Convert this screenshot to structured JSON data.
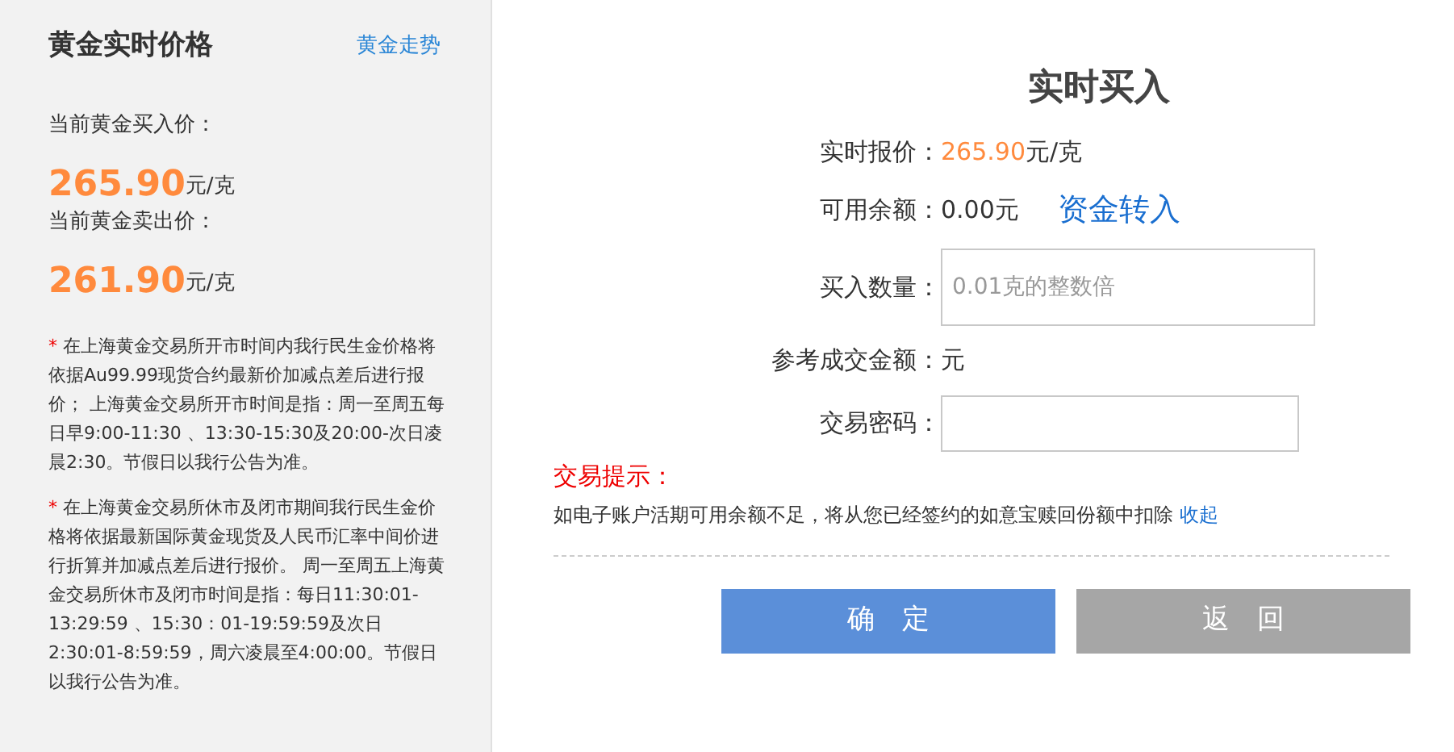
{
  "sidebar": {
    "title": "黄金实时价格",
    "trend_link": "黄金走势",
    "prices": [
      {
        "label": "当前黄金买入价：",
        "value": "265.90",
        "unit": "元/克"
      },
      {
        "label": "当前黄金卖出价：",
        "value": "261.90",
        "unit": "元/克"
      }
    ],
    "notes": [
      {
        "mark": "*",
        "text": "在上海黄金交易所开市时间内我行民生金价格将依据Au99.99现货合约最新价加减点差后进行报价； 上海黄金交易所开市时间是指：周一至周五每日早9:00-11:30 、13:30-15:30及20:00-次日凌晨2:30。节假日以我行公告为准。"
      },
      {
        "mark": "*",
        "text": "在上海黄金交易所休市及闭市期间我行民生金价格将依据最新国际黄金现货及人民币汇率中间价进行折算并加减点差后进行报价。 周一至周五上海黄金交易所休市及闭市时间是指：每日11:30:01-13:29:59 、15:30：01-19:59:59及次日2:30:01-8:59:59，周六凌晨至4:00:00。节假日以我行公告为准。"
      }
    ]
  },
  "form": {
    "title": "实时买入",
    "rows": [
      {
        "kind": "price",
        "label": "实时报价：",
        "value": "265.90",
        "unit": "元/克"
      },
      {
        "kind": "balance",
        "label": "可用余额：",
        "value": "0.00元",
        "link": "资金转入"
      },
      {
        "kind": "input",
        "label": "买入数量：",
        "placeholder": "0.01克的整数倍"
      },
      {
        "kind": "text",
        "label": "参考成交金额：",
        "value": "元"
      },
      {
        "kind": "password",
        "label": "交易密码："
      }
    ],
    "tip_title": "交易提示：",
    "tip_text": "如电子账户活期可用余额不足，将从您已经签约的如意宝赎回份额中扣除",
    "tip_link": "收起",
    "buttons": [
      {
        "label": "确　定",
        "kind": "primary"
      },
      {
        "label": "返　回",
        "kind": "secondary"
      }
    ]
  }
}
